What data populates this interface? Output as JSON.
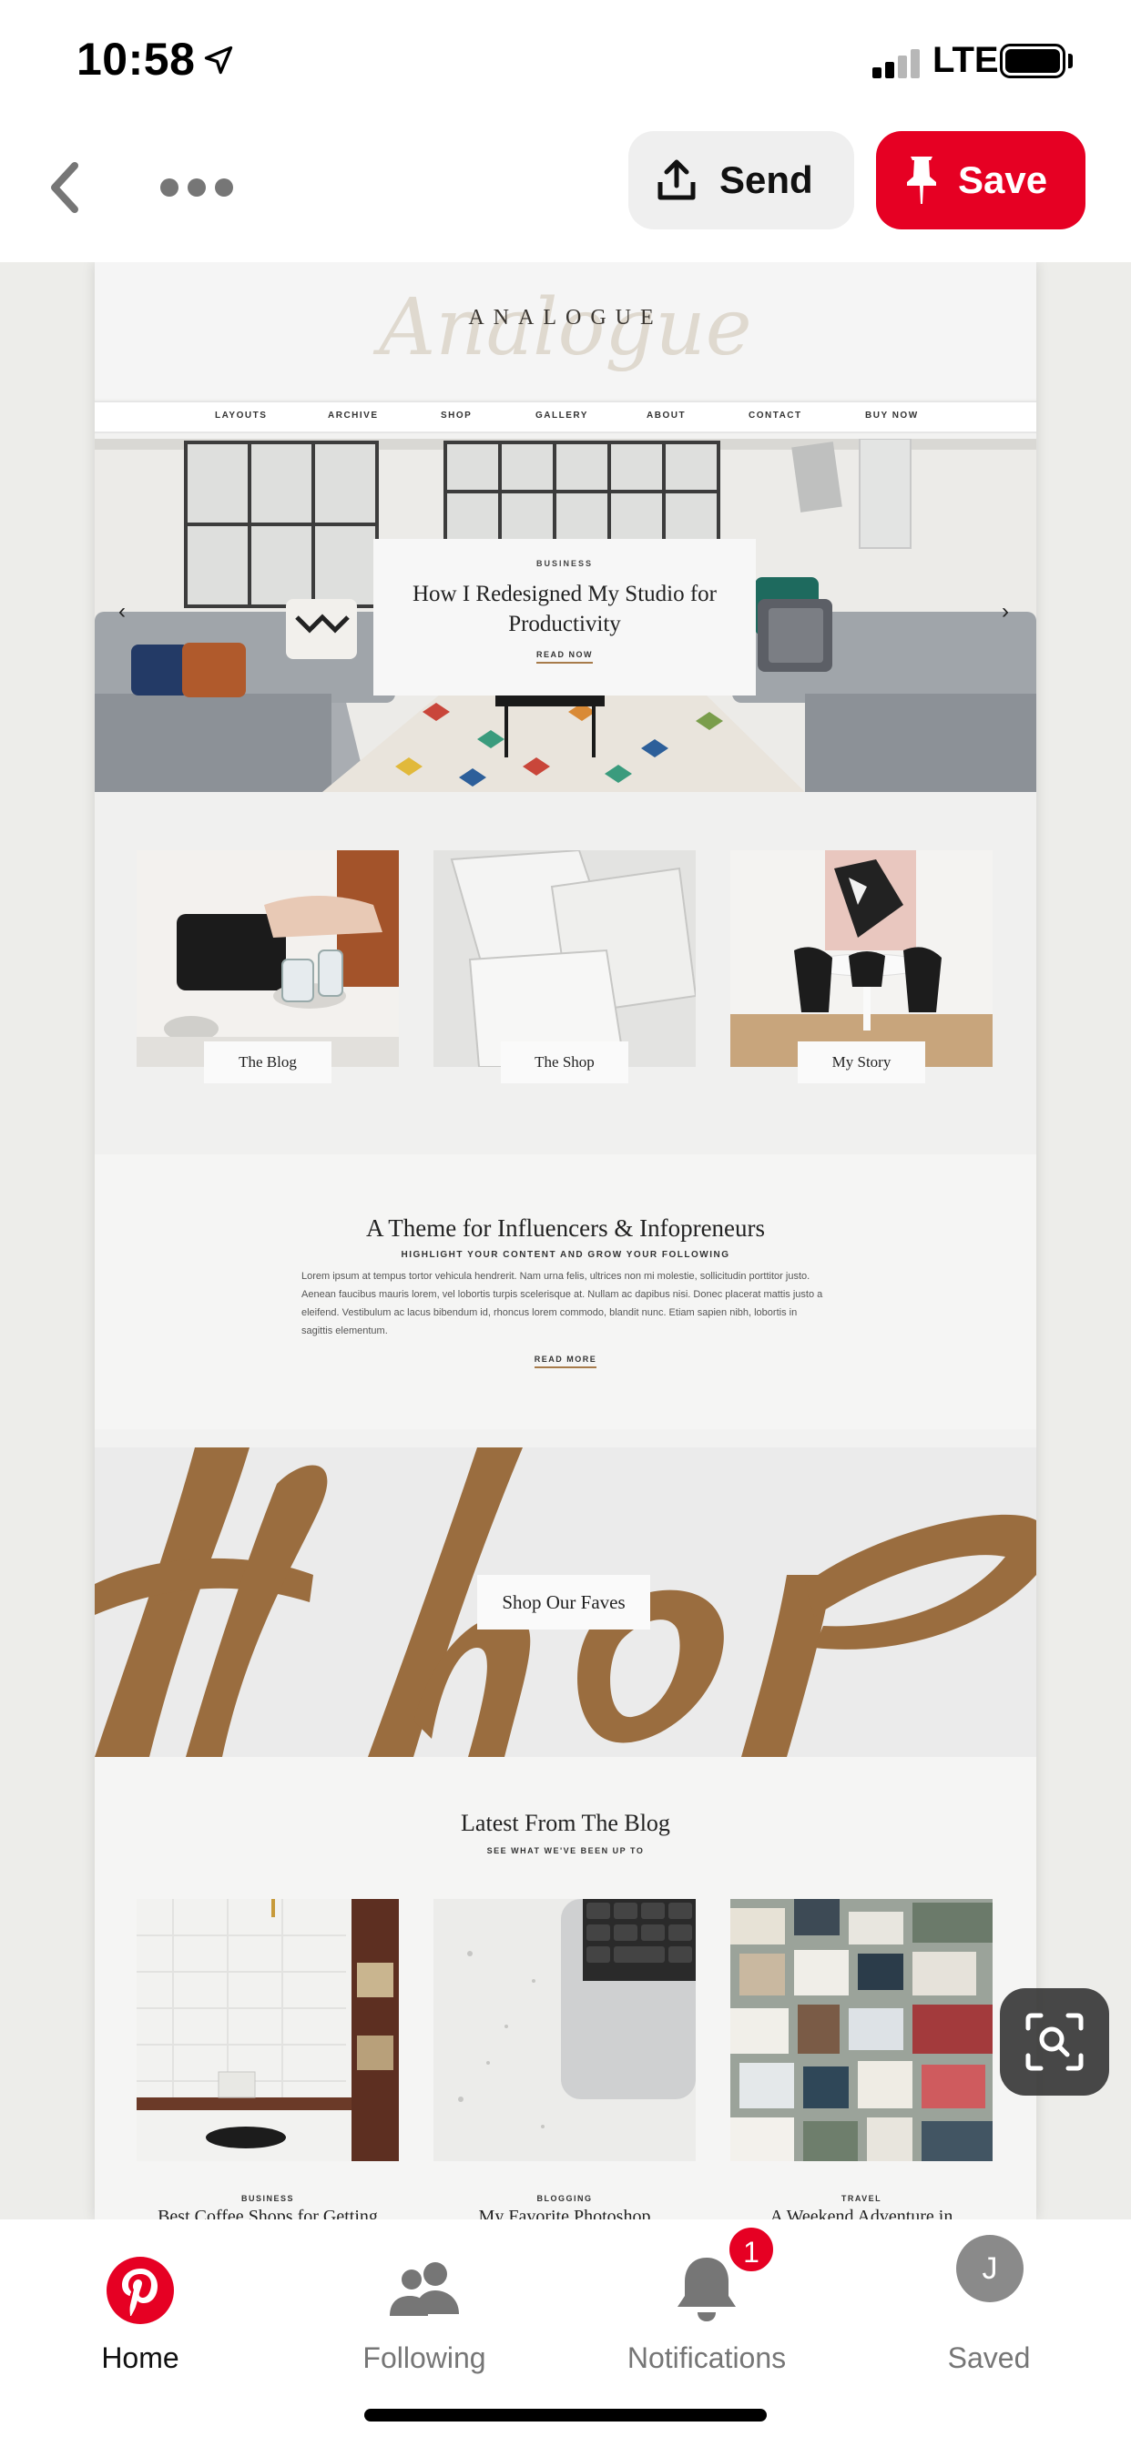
{
  "status_bar": {
    "time": "10:58",
    "network": "LTE",
    "icons": [
      "location-arrow-icon",
      "signal-icon",
      "battery-icon"
    ]
  },
  "action_bar": {
    "back_icon": "chevron-left-icon",
    "more_icon": "more-horizontal-icon",
    "send_label": "Send",
    "save_label": "Save",
    "colors": {
      "save": "#e60023",
      "send_bg": "#efefef"
    }
  },
  "pin": {
    "brand": "ANALOGUE",
    "nav": [
      "LAYOUTS",
      "ARCHIVE",
      "SHOP",
      "GALLERY",
      "ABOUT",
      "CONTACT",
      "BUY NOW"
    ],
    "hero": {
      "category": "BUSINESS",
      "title": "How I Redesigned My Studio for Productivity",
      "cta": "READ NOW",
      "prev": "‹",
      "next": "›"
    },
    "tiles": [
      {
        "label": "The Blog"
      },
      {
        "label": "The Shop"
      },
      {
        "label": "My Story"
      }
    ],
    "theme": {
      "title": "A Theme for Influencers & Infopreneurs",
      "subtitle": "HIGHLIGHT YOUR CONTENT AND GROW YOUR FOLLOWING",
      "body": "Lorem ipsum at tempus tortor vehicula hendrerit. Nam urna felis, ultrices non mi molestie, sollicitudin porttitor justo. Aenean faucibus mauris lorem, vel lobortis turpis scelerisque at. Nullam ac dapibus nisi. Donec placerat mattis justo a eleifend. Vestibulum ac lacus bibendum id, rhoncus lorem commodo, blandit nunc. Etiam sapien nibh, lobortis in sagittis elementum.",
      "cta": "READ MORE"
    },
    "shop": {
      "button": "Shop Our Faves",
      "accent": "#9a6d3f"
    },
    "blog": {
      "title": "Latest From The Blog",
      "subtitle": "SEE WHAT WE'VE BEEN UP TO",
      "posts": [
        {
          "category": "BUSINESS",
          "title": "Best Coffee Shops for Getting"
        },
        {
          "category": "BLOGGING",
          "title": "My Favorite Photoshop"
        },
        {
          "category": "TRAVEL",
          "title": "A Weekend Adventure in"
        }
      ]
    }
  },
  "lens_icon": "visual-search-icon",
  "tab_bar": {
    "tabs": [
      {
        "label": "Home",
        "icon": "pinterest-logo-icon",
        "active": true
      },
      {
        "label": "Following",
        "icon": "people-icon",
        "active": false
      },
      {
        "label": "Notifications",
        "icon": "bell-icon",
        "active": false
      },
      {
        "label": "Saved",
        "icon": "avatar",
        "active": false
      }
    ],
    "notification_count": "1",
    "avatar_initial": "J"
  }
}
